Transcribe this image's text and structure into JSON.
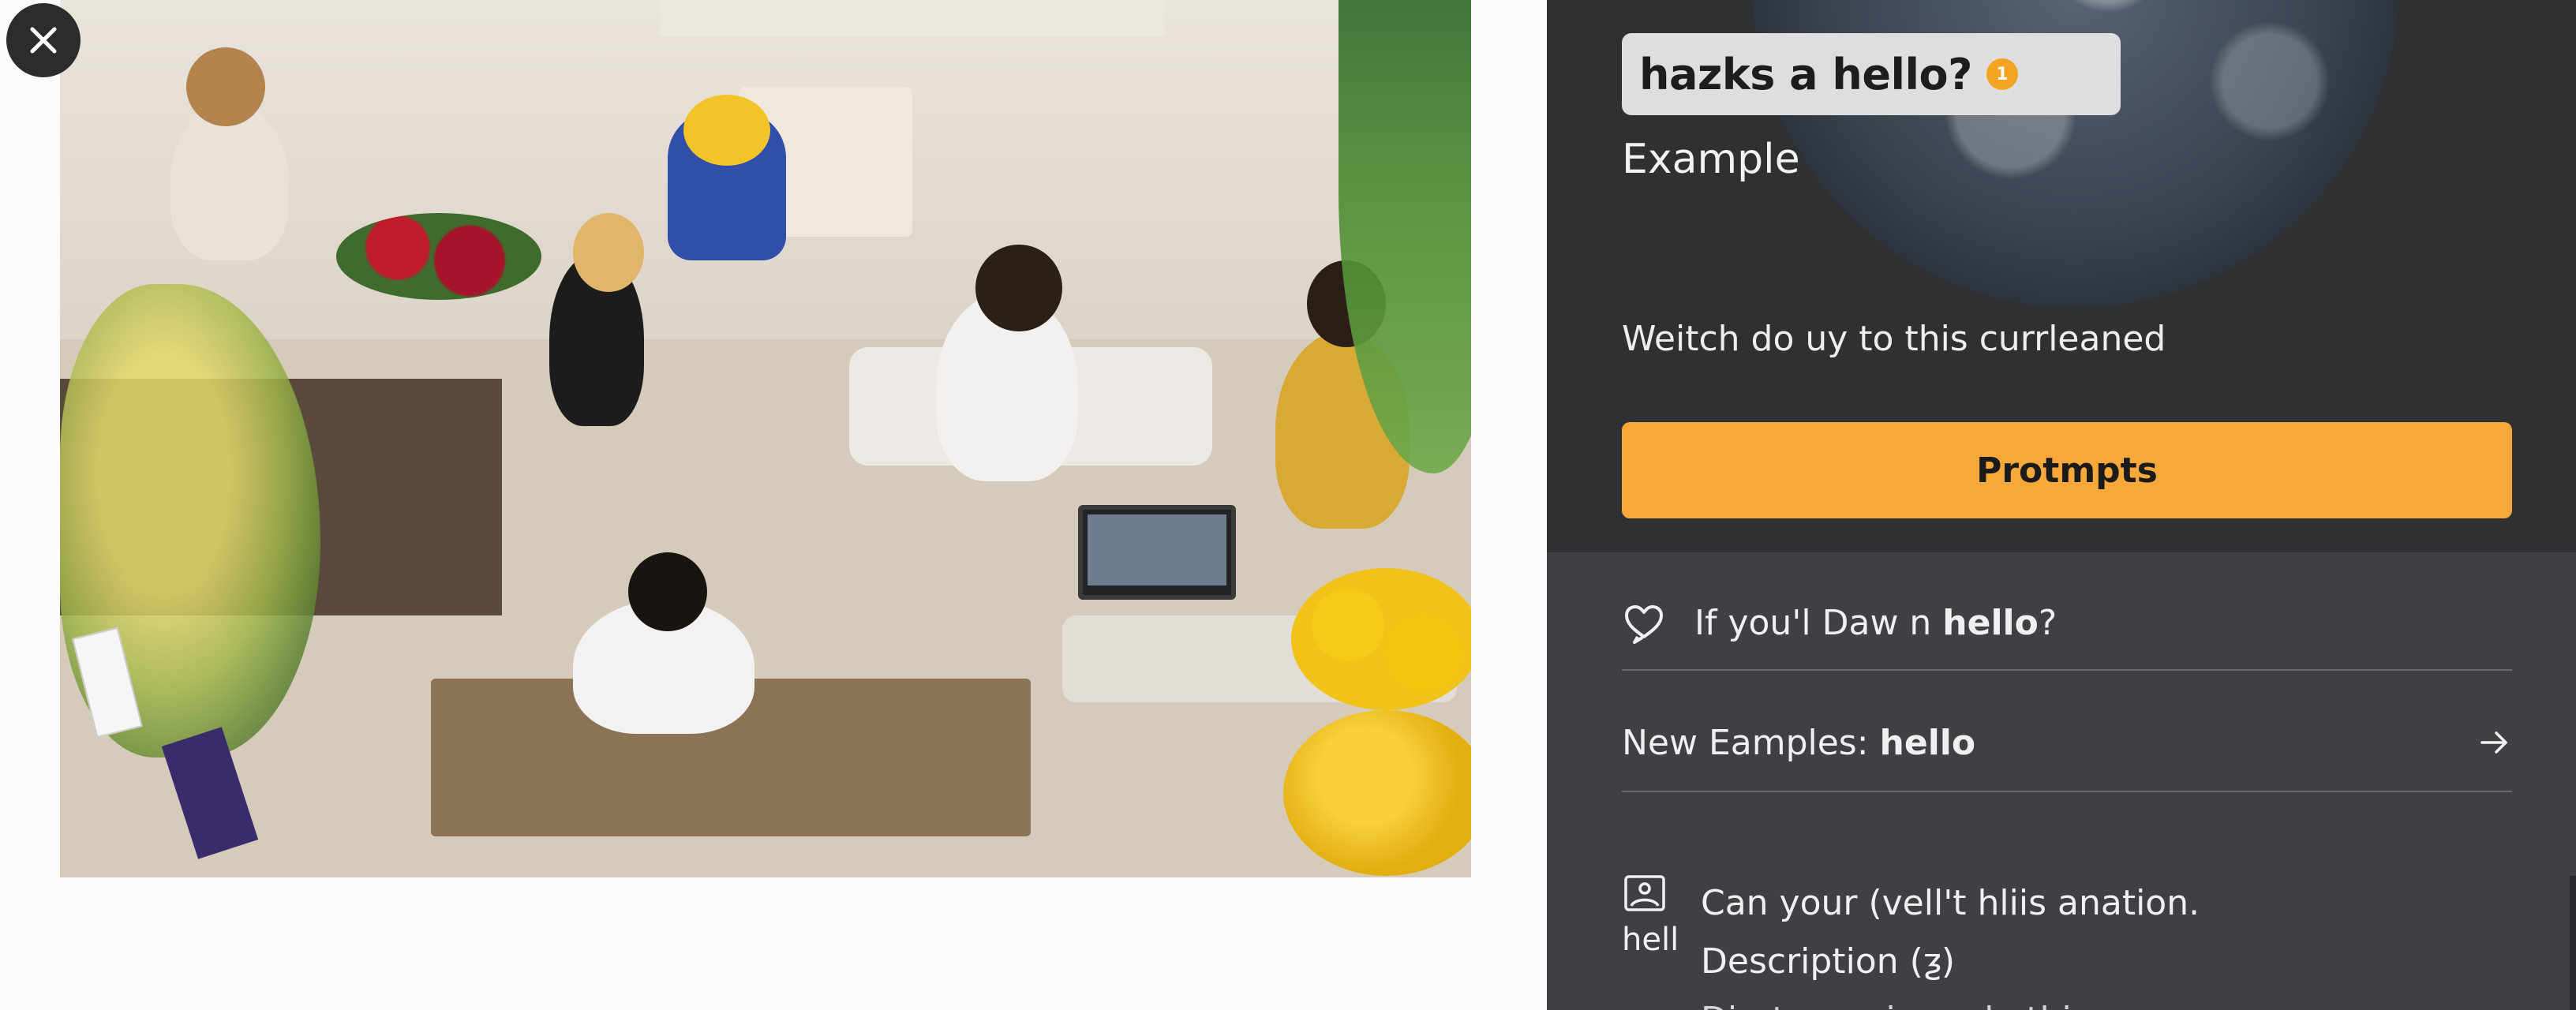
{
  "header": {
    "question": "hazks a hello?",
    "badge": "1",
    "example_label": "Example",
    "subtitle": "Weitch do uy to this currleaned",
    "primary_button_label": "Protmpts"
  },
  "rows": {
    "suggestion": {
      "prefix": "If you'l Daw n ",
      "bold": "hello",
      "suffix": "?"
    },
    "new_examples": {
      "prefix": "New Eamples: ",
      "bold": "hello"
    }
  },
  "bottom": {
    "icon_caption": "hell",
    "lines": [
      "Can your (vell't hliis anation.",
      "Description (ƺ)",
      "Diret your in ande thins"
    ]
  },
  "colors": {
    "accent": "#f7a83a",
    "panel_bg": "#3f4043",
    "panel_top_bg": "#2f3032",
    "chip_bg": "#dedede",
    "badge": "#f3a421"
  },
  "icons": {
    "close": "close-icon",
    "suggestion": "heart-chat-icon",
    "arrow": "arrow-right-icon",
    "bottom": "image-frame-icon"
  }
}
